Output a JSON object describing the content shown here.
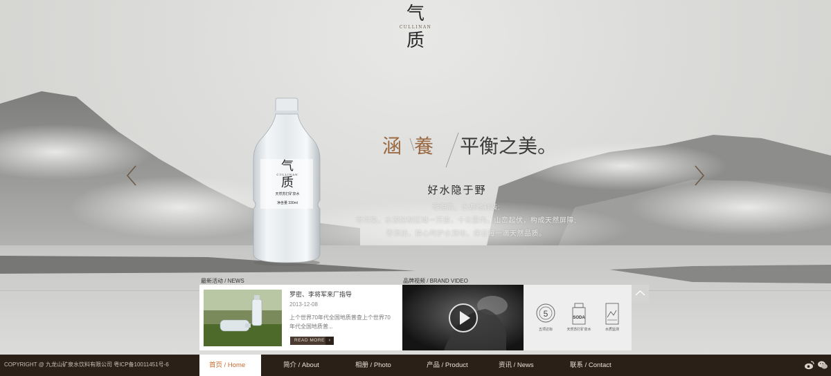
{
  "logo": {
    "cn_top": "气",
    "en": "CULLINAN",
    "cn_bottom": "质"
  },
  "hero": {
    "slogan": {
      "w1": "涵",
      "w2": "養",
      "w3": "平衡之美。"
    },
    "tagline": "好水隐于野",
    "desc": [
      "零距离，水源地封装;",
      "零污染，水源控制区域一万亩，十公里内，山峦起伏，构成天然屏障;",
      "零添加，精心呵护水源地，保证每一滴天然品质。"
    ],
    "bottle_label": {
      "cn_top": "气",
      "en": "CULLINAN",
      "cn_bottom": "质",
      "line1": "天然苏打矿泉水",
      "line2": "净含量 330ml"
    }
  },
  "news": {
    "label": "最新活动 / NEWS",
    "title": "罗密、李将军来厂指导",
    "date": "2013-12-08",
    "body": "上个世界70年代全国地质普查上个世界70年代全国地质普...",
    "read_more": "READ MORE"
  },
  "video": {
    "label": "品牌视频 / BRAND VIDEO"
  },
  "certs": [
    {
      "mark": "5",
      "caption": "五项达标"
    },
    {
      "mark": "SODA",
      "caption": "天然苏打矿泉水"
    },
    {
      "mark": "",
      "caption": "水质监测"
    }
  ],
  "footer": {
    "copyright": "COPYRIGHT @ 九龙山矿泉水饮料有限公司   粤ICP备10011451号-6",
    "nav": [
      {
        "label": "首页  /  Home",
        "active": true
      },
      {
        "label": "简介  /  About",
        "active": false
      },
      {
        "label": "相册  /  Photo",
        "active": false
      },
      {
        "label": "产品  /  Product",
        "active": false
      },
      {
        "label": "资讯  /  News",
        "active": false
      },
      {
        "label": "联系  /  Contact",
        "active": false
      }
    ]
  },
  "colors": {
    "accent": "#9a6a44",
    "footer_bg": "#2b2018",
    "nav_active": "#c86a2c"
  },
  "icons": [
    "left-arrow-icon",
    "right-arrow-icon",
    "play-icon",
    "scroll-top-icon",
    "weibo-icon",
    "wechat-icon"
  ]
}
